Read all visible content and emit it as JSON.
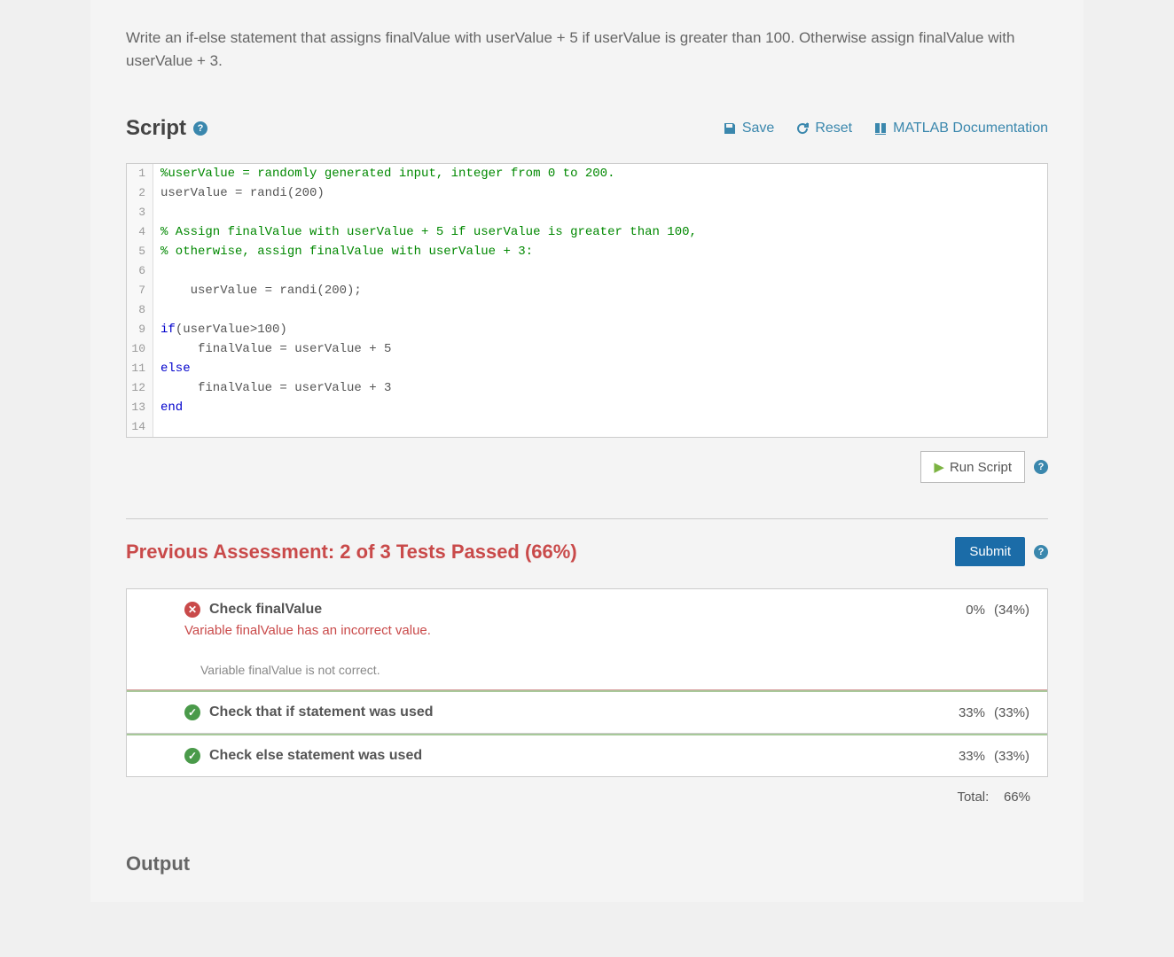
{
  "question": "Write an if-else statement that assigns finalValue with userValue + 5 if userValue is greater than 100. Otherwise assign finalValue with userValue + 3.",
  "script_section": {
    "title": "Script",
    "actions": {
      "save": "Save",
      "reset": "Reset",
      "docs": "MATLAB Documentation"
    }
  },
  "code_lines": [
    {
      "n": 1,
      "content": "%userValue = randomly generated input, integer from 0 to 200.",
      "type": "comment"
    },
    {
      "n": 2,
      "content": "userValue = randi(200)",
      "type": "code"
    },
    {
      "n": 3,
      "content": "",
      "type": "code"
    },
    {
      "n": 4,
      "content": "% Assign finalValue with userValue + 5 if userValue is greater than 100,",
      "type": "comment"
    },
    {
      "n": 5,
      "content": "% otherwise, assign finalValue with userValue + 3:",
      "type": "comment"
    },
    {
      "n": 6,
      "content": "",
      "type": "code"
    },
    {
      "n": 7,
      "content": "    userValue = randi(200);",
      "type": "code"
    },
    {
      "n": 8,
      "content": "",
      "type": "code"
    },
    {
      "n": 9,
      "content": "if(userValue>100)",
      "type": "keyword-line",
      "keyword": "if",
      "rest": "(userValue>100)"
    },
    {
      "n": 10,
      "content": "     finalValue = userValue + 5",
      "type": "code"
    },
    {
      "n": 11,
      "content": "else",
      "type": "keyword-line",
      "keyword": "else",
      "rest": ""
    },
    {
      "n": 12,
      "content": "     finalValue = userValue + 3",
      "type": "code"
    },
    {
      "n": 13,
      "content": "end",
      "type": "keyword-line",
      "keyword": "end",
      "rest": ""
    },
    {
      "n": 14,
      "content": "",
      "type": "code"
    }
  ],
  "run_button": "Run Script",
  "assessment": {
    "title": "Previous Assessment: 2 of 3 Tests Passed (66%)",
    "submit": "Submit"
  },
  "tests": [
    {
      "status": "fail",
      "name": "Check finalValue",
      "detail": "Variable finalValue has an incorrect value.",
      "subdetail": "Variable finalValue is not correct.",
      "score": "0%",
      "weight": "(34%)"
    },
    {
      "status": "pass",
      "name": "Check that if statement was used",
      "score": "33%",
      "weight": "(33%)"
    },
    {
      "status": "pass",
      "name": "Check else statement was used",
      "score": "33%",
      "weight": "(33%)"
    }
  ],
  "total": {
    "label": "Total:",
    "value": "66%"
  },
  "output_heading": "Output"
}
